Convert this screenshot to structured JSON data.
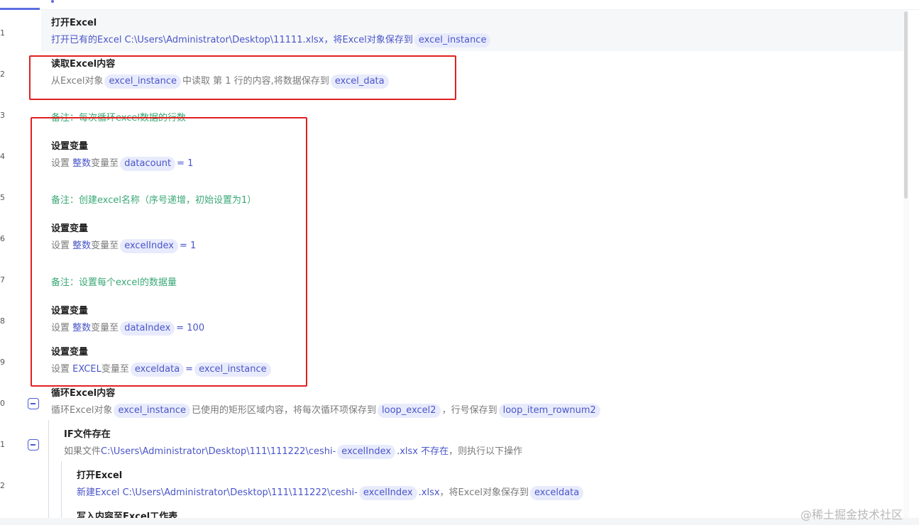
{
  "line_numbers": [
    "1",
    "2",
    "3",
    "4",
    "5",
    "6",
    "7",
    "8",
    "9",
    "0",
    "1",
    "2"
  ],
  "steps": {
    "s1": {
      "title": "打开Excel",
      "pre": "打开已有的Excel C:\\Users\\Administrator\\Desktop\\11111.xlsx，将Excel对象保存到",
      "tag1": "excel_instance"
    },
    "s2": {
      "title": "读取Excel内容",
      "pre": "从Excel对象",
      "tag1": "excel_instance",
      "mid": "中读取 第 1 行的内容,将数据保存到",
      "tag2": "excel_data"
    },
    "c3": "备注：每次循环excel数据的行数",
    "s4": {
      "title": "设置变量",
      "pre": "设置",
      "type": "整数",
      "mid": "变量至",
      "tag1": "datacount",
      "post": "= 1"
    },
    "c5": "备注：创建excel名称（序号递增，初始设置为1）",
    "s6": {
      "title": "设置变量",
      "pre": "设置",
      "type": "整数",
      "mid": "变量至",
      "tag1": "excelIndex",
      "post": "= 1"
    },
    "c7": "备注：设置每个excel的数据量",
    "s8": {
      "title": "设置变量",
      "pre": "设置",
      "type": "整数",
      "mid": "变量至",
      "tag1": "dataIndex",
      "post": "= 100"
    },
    "s9": {
      "title": "设置变量",
      "pre": "设置",
      "type": "EXCEL",
      "mid": "变量至",
      "tag1": "exceldata",
      "eq": "=",
      "tag2": "excel_instance"
    },
    "s10": {
      "title": "循环Excel内容",
      "pre": "循环Excel对象",
      "tag1": "excel_instance",
      "mid": "已使用的矩形区域内容，将每次循环项保存到",
      "tag2": "loop_excel2",
      "mid2": "，行号保存到",
      "tag3": "loop_item_rownum2"
    },
    "s11": {
      "title": "IF文件存在",
      "pre": "如果文件",
      "path": "C:\\Users\\Administrator\\Desktop\\111\\111222\\ceshi-",
      "tag1": "excelIndex",
      "ext": ".xlsx 不存在",
      "post": "，则执行以下操作"
    },
    "s12": {
      "title": "打开Excel",
      "pre": "新建Excel C:\\Users\\Administrator\\Desktop\\111\\111222\\ceshi-",
      "tag1": "excelIndex",
      "ext": ".xlsx",
      "post": "，将Excel对象保存到",
      "tag2": "exceldata"
    },
    "s13": {
      "title": "写入内容至Excel工作表"
    }
  },
  "watermark": "@稀土掘金技术社区",
  "colors": {
    "accent": "#4a56c8",
    "comment": "#3aa876",
    "highlight_box": "#e02020",
    "tag_bg": "#e8ebfc"
  }
}
